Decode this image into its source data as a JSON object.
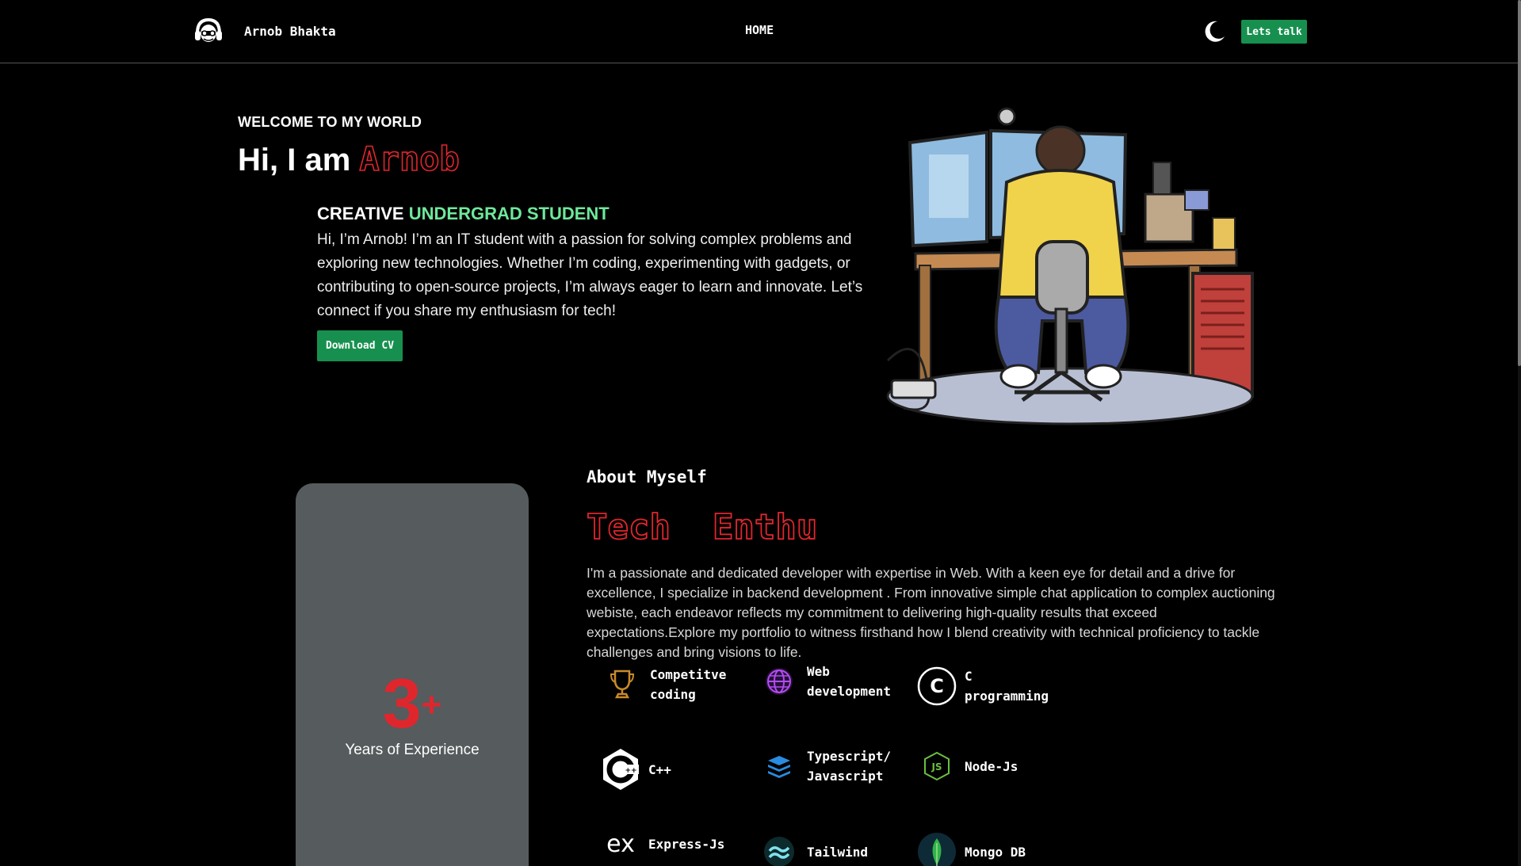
{
  "nav": {
    "brand": "Arnob Bhakta",
    "home": "HOME",
    "talk_button": "Lets talk",
    "theme_icon": "moon-icon",
    "logo_icon": "avatar-logo-icon"
  },
  "hero": {
    "welcome": "WELCOME TO MY WORLD",
    "greeting": "Hi, I am",
    "name": "Arnob",
    "role_prefix": "CREATIVE",
    "role_highlight": "UNDERGRAD STUDENT",
    "intro": "Hi, I’m Arnob! I’m an IT student with a passion for solving complex problems and exploring new technologies. Whether I’m coding, experimenting with gadgets, or contributing to open-source projects, I’m always eager to learn and innovate. Let’s connect if you share my enthusiasm for tech!",
    "cv_button": "Download CV"
  },
  "experience": {
    "number": "3",
    "suffix": "+",
    "label": "Years of Experience"
  },
  "about": {
    "heading": "About Myself",
    "title": "Tech  Enthu",
    "body": "I'm a passionate and dedicated developer with expertise in Web. With a keen eye for detail and a drive for excellence, I specialize in backend development . From innovative simple chat application to complex auctioning webiste, each endeavor reflects my commitment to delivering high-quality results that exceed expectations.Explore my portfolio to witness firsthand how I blend creativity with technical proficiency to tackle challenges and bring visions to life."
  },
  "skills": [
    {
      "line1": "Competitve",
      "line2": "coding",
      "icon": "trophy-icon"
    },
    {
      "line1": "Web",
      "line2": "development",
      "icon": "globe-icon"
    },
    {
      "line1": "C",
      "line2": "programming",
      "icon": "c-language-icon"
    },
    {
      "line1": "C++",
      "line2": "",
      "icon": "cpp-icon"
    },
    {
      "line1": "Typescript/",
      "line2": "Javascript",
      "icon": "stack-icon"
    },
    {
      "line1": "Node-Js",
      "line2": "",
      "icon": "nodejs-icon"
    },
    {
      "line1": "Express-Js",
      "line2": "",
      "icon": "express-icon"
    },
    {
      "line1": "Tailwind",
      "line2": "",
      "icon": "tailwind-icon"
    },
    {
      "line1": "Mongo DB",
      "line2": "",
      "icon": "mongodb-icon"
    }
  ],
  "colors": {
    "accent_green": "#17904f",
    "accent_red": "#e0262d",
    "highlight_green": "#6ee89b",
    "card_gray": "#565b5d"
  }
}
